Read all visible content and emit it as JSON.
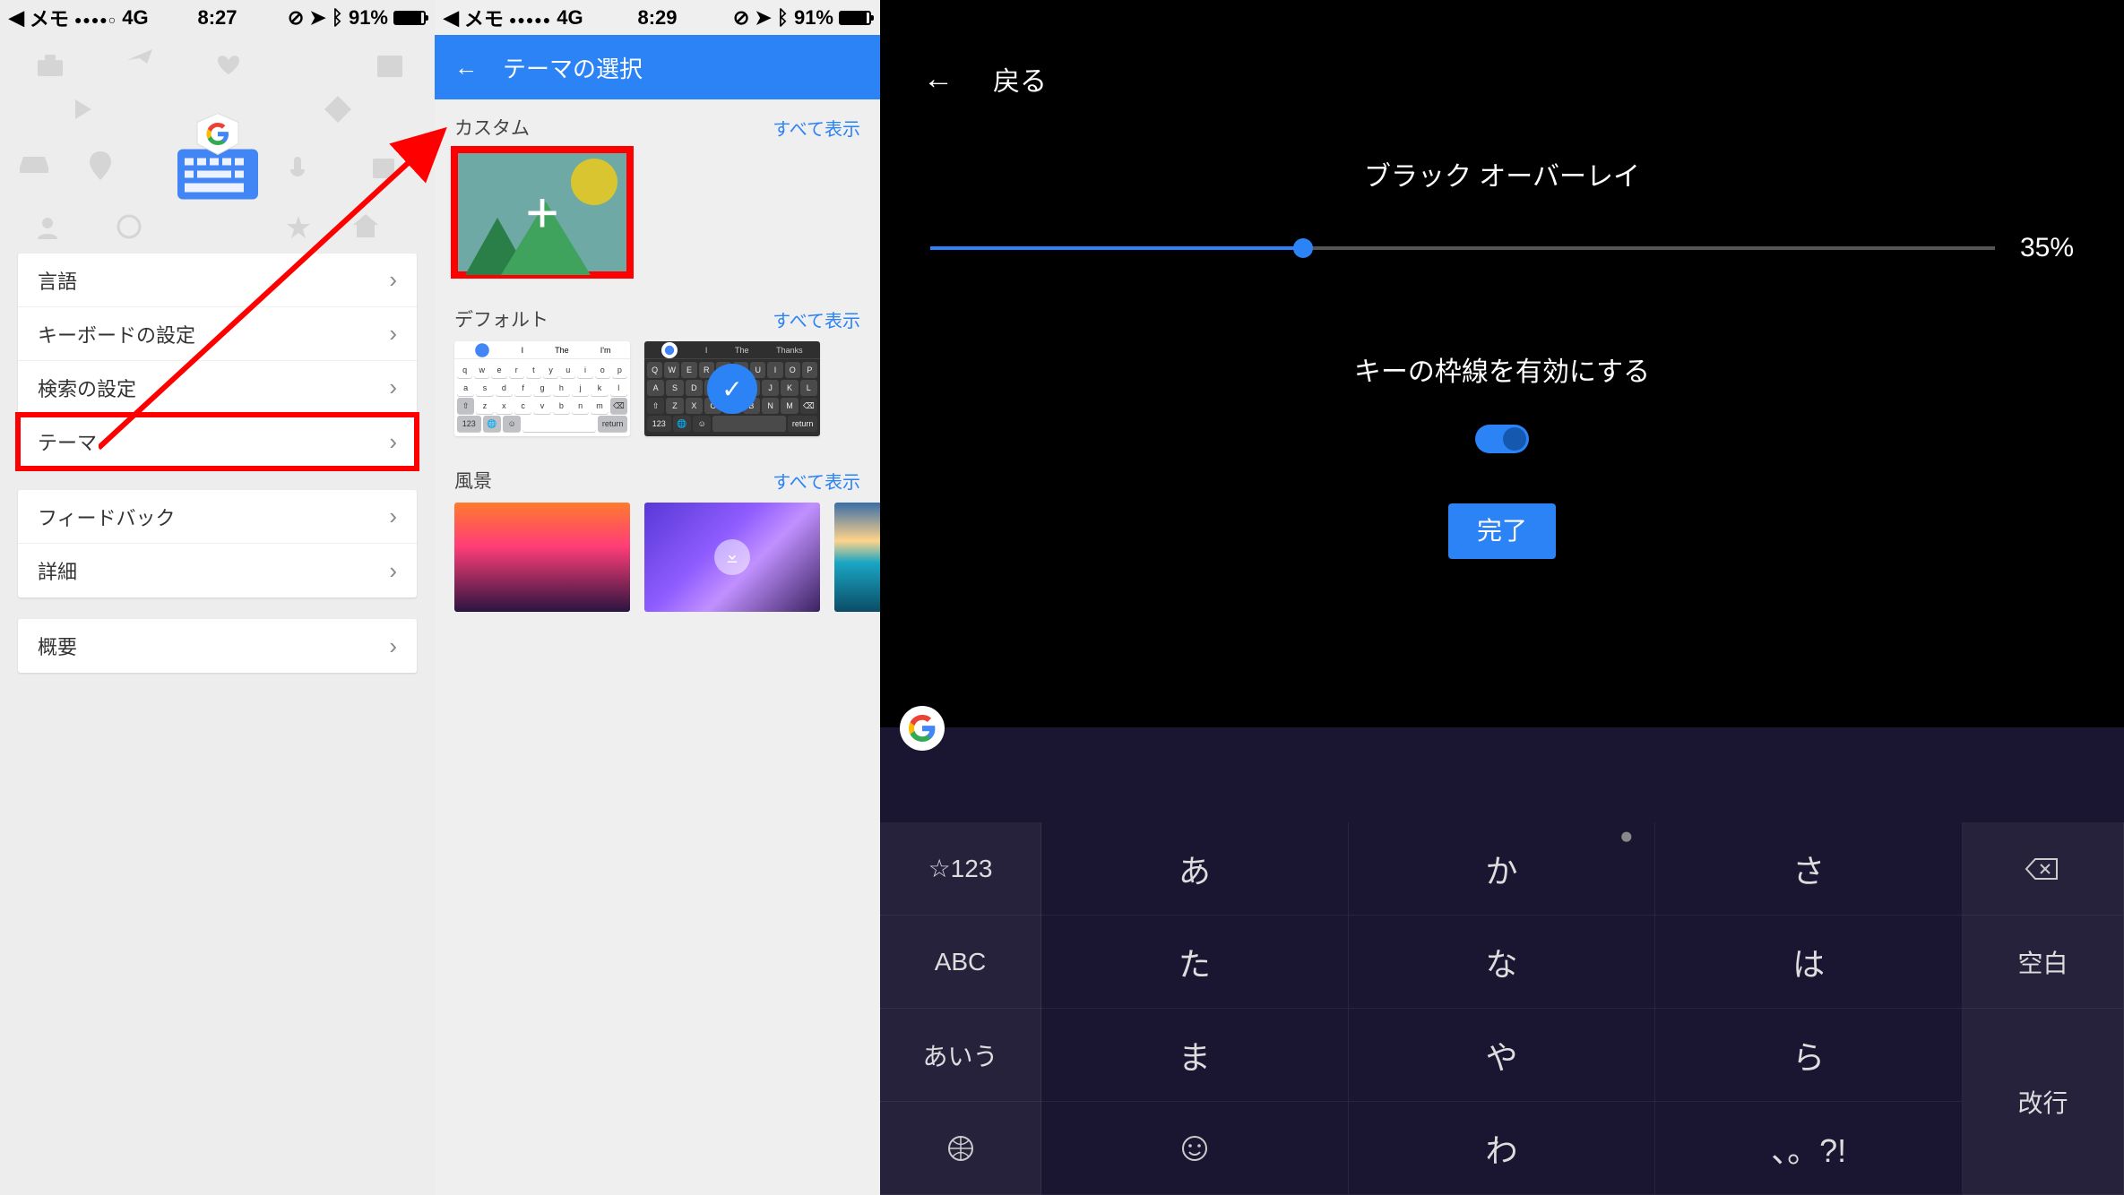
{
  "pane1": {
    "status": {
      "back_app": "メモ",
      "carrier": "4G",
      "time": "8:27",
      "battery": "91%"
    },
    "menu1": [
      {
        "label": "言語"
      },
      {
        "label": "キーボードの設定"
      },
      {
        "label": "検索の設定"
      },
      {
        "label": "テーマ",
        "highlight": true
      }
    ],
    "menu2": [
      {
        "label": "フィードバック"
      },
      {
        "label": "詳細"
      }
    ],
    "menu3": [
      {
        "label": "概要"
      }
    ]
  },
  "pane2": {
    "status": {
      "back_app": "メモ",
      "carrier": "4G",
      "time": "8:29",
      "battery": "91%"
    },
    "title": "テーマの選択",
    "show_all": "すべて表示",
    "section_custom": "カスタム",
    "section_default": "デフォルト",
    "section_landscape": "風景",
    "kb_sugg_light": [
      "I",
      "The",
      "I'm"
    ],
    "kb_sugg_dark": [
      "I",
      "The",
      "Thanks"
    ],
    "kb_return": "return",
    "kb_123": "123"
  },
  "pane3": {
    "back": "戻る",
    "overlay_label": "ブラック オーバーレイ",
    "overlay_pct": 35,
    "overlay_pct_label": "35%",
    "borders_label": "キーの枠線を有効にする",
    "done": "完了",
    "keys": {
      "num": "☆123",
      "abc": "ABC",
      "kana": "あいう",
      "space": "空白",
      "enter": "改行",
      "r1": [
        "あ",
        "か",
        "さ"
      ],
      "r2": [
        "た",
        "な",
        "は"
      ],
      "r3": [
        "ま",
        "や",
        "ら"
      ],
      "r4": [
        "わ",
        "、。?!"
      ]
    }
  }
}
